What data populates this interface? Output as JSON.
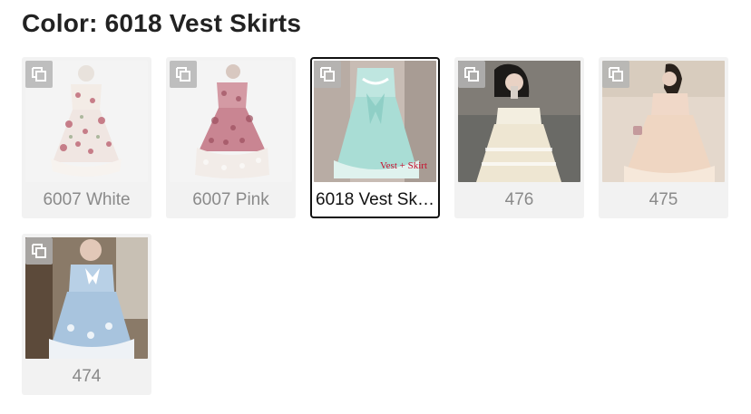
{
  "header": {
    "label": "Color:",
    "value": "6018 Vest Skirts"
  },
  "swatches": [
    {
      "caption": "6007 White",
      "image": "floral-white-dress",
      "selected": false,
      "overlay": ""
    },
    {
      "caption": "6007 Pink",
      "image": "floral-pink-dress",
      "selected": false,
      "overlay": ""
    },
    {
      "caption": "6018 Vest Skirts",
      "image": "mint-bow-dress",
      "selected": true,
      "overlay": "Vest + Skirt"
    },
    {
      "caption": "476",
      "image": "cream-lace-dress-photo",
      "selected": false,
      "overlay": ""
    },
    {
      "caption": "475",
      "image": "peach-ruffle-dress-photo",
      "selected": false,
      "overlay": ""
    },
    {
      "caption": "474",
      "image": "blue-bow-dress-photo",
      "selected": false,
      "overlay": ""
    }
  ],
  "icons": {
    "zoom": "expand-image-icon"
  },
  "colors": {
    "selected_border": "#111111",
    "card_bg": "#f2f2f2",
    "caption": "#8a8a8a",
    "overlay_text": "#c8102e"
  }
}
